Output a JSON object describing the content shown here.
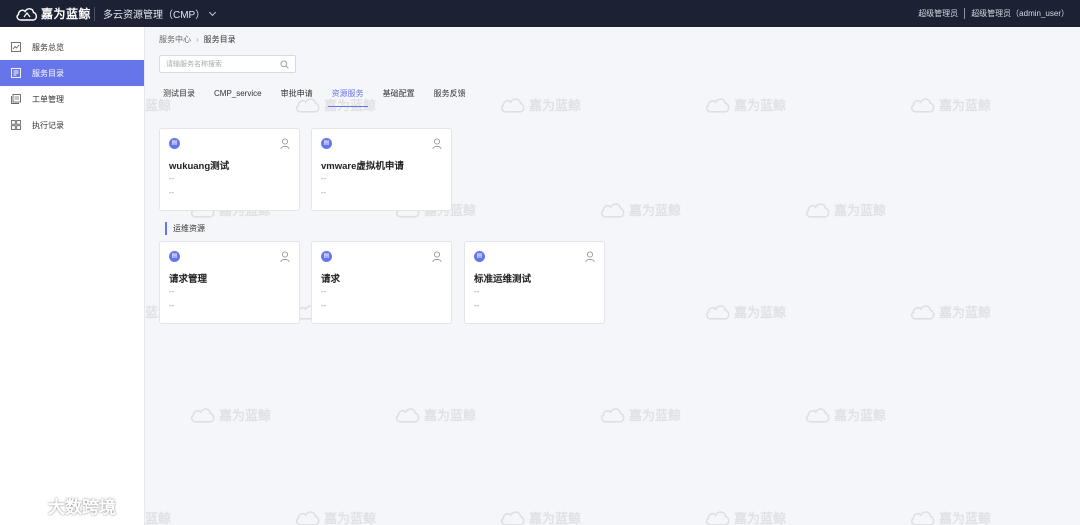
{
  "topbar": {
    "logo_text": "嘉为蓝鲸",
    "product": "多云资源管理（CMP）",
    "role": "超级管理员",
    "user": "超级管理员（admin_user）"
  },
  "sidebar": {
    "items": [
      {
        "label": "服务总览",
        "icon": "overview-icon"
      },
      {
        "label": "服务目录",
        "icon": "catalog-icon",
        "active": true
      },
      {
        "label": "工单管理",
        "icon": "ticket-icon"
      },
      {
        "label": "执行记录",
        "icon": "records-icon"
      }
    ]
  },
  "breadcrumb": {
    "parent": "服务中心",
    "separator": "›",
    "current": "服务目录"
  },
  "search": {
    "placeholder": "请输服务名称搜索",
    "value": ""
  },
  "tabs": [
    {
      "label": "测试目录"
    },
    {
      "label": "CMP_service"
    },
    {
      "label": "审批申请"
    },
    {
      "label": "资源服务",
      "active": true
    },
    {
      "label": "基础配置"
    },
    {
      "label": "服务反馈"
    }
  ],
  "cards_top": [
    {
      "title": "wukuang测试",
      "line1": "--",
      "line2": "--"
    },
    {
      "title": "vmware虚拟机申请",
      "line1": "--",
      "line2": "--"
    }
  ],
  "section": {
    "title": "运维资源"
  },
  "cards_section": [
    {
      "title": "请求管理",
      "line1": "--",
      "line2": "--"
    },
    {
      "title": "请求",
      "line1": "--",
      "line2": "--"
    },
    {
      "title": "标准运维测试",
      "line1": "--",
      "line2": "--"
    }
  ],
  "watermark": {
    "text": "嘉为蓝鲸"
  },
  "corner_badge": {
    "text": "大数跨境"
  },
  "colors": {
    "topbar": "#1c2233",
    "accent": "#6675ea",
    "page_bg": "#f5f6fa"
  }
}
